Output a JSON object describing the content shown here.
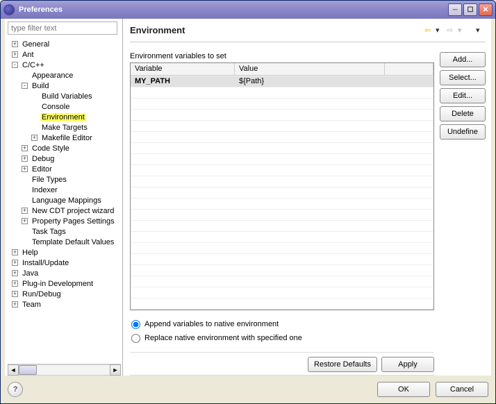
{
  "window": {
    "title": "Preferences"
  },
  "filter": {
    "placeholder": "type filter text"
  },
  "tree": {
    "nodes": [
      {
        "indent": 0,
        "twisty": "+",
        "label": "General"
      },
      {
        "indent": 0,
        "twisty": "+",
        "label": "Ant"
      },
      {
        "indent": 0,
        "twisty": "-",
        "label": "C/C++"
      },
      {
        "indent": 1,
        "twisty": "",
        "label": "Appearance"
      },
      {
        "indent": 1,
        "twisty": "-",
        "label": "Build"
      },
      {
        "indent": 2,
        "twisty": "",
        "label": "Build Variables"
      },
      {
        "indent": 2,
        "twisty": "",
        "label": "Console"
      },
      {
        "indent": 2,
        "twisty": "",
        "label": "Environment",
        "selected": true
      },
      {
        "indent": 2,
        "twisty": "",
        "label": "Make Targets"
      },
      {
        "indent": 2,
        "twisty": "+",
        "label": "Makefile Editor"
      },
      {
        "indent": 1,
        "twisty": "+",
        "label": "Code Style"
      },
      {
        "indent": 1,
        "twisty": "+",
        "label": "Debug"
      },
      {
        "indent": 1,
        "twisty": "+",
        "label": "Editor"
      },
      {
        "indent": 1,
        "twisty": "",
        "label": "File Types"
      },
      {
        "indent": 1,
        "twisty": "",
        "label": "Indexer"
      },
      {
        "indent": 1,
        "twisty": "",
        "label": "Language Mappings"
      },
      {
        "indent": 1,
        "twisty": "+",
        "label": "New CDT project wizard"
      },
      {
        "indent": 1,
        "twisty": "+",
        "label": "Property Pages Settings"
      },
      {
        "indent": 1,
        "twisty": "",
        "label": "Task Tags"
      },
      {
        "indent": 1,
        "twisty": "",
        "label": "Template Default Values"
      },
      {
        "indent": 0,
        "twisty": "+",
        "label": "Help"
      },
      {
        "indent": 0,
        "twisty": "+",
        "label": "Install/Update"
      },
      {
        "indent": 0,
        "twisty": "+",
        "label": "Java"
      },
      {
        "indent": 0,
        "twisty": "+",
        "label": "Plug-in Development"
      },
      {
        "indent": 0,
        "twisty": "+",
        "label": "Run/Debug"
      },
      {
        "indent": 0,
        "twisty": "+",
        "label": "Team"
      }
    ]
  },
  "page": {
    "heading": "Environment",
    "table_caption": "Environment variables to set",
    "columns": {
      "variable": "Variable",
      "value": "Value"
    },
    "rows": [
      {
        "variable": "MY_PATH",
        "value": "${Path}",
        "selected": true
      }
    ],
    "radios": {
      "append": "Append variables to native environment",
      "replace": "Replace native environment with specified one"
    }
  },
  "buttons": {
    "add": "Add...",
    "select": "Select...",
    "edit": "Edit...",
    "delete": "Delete",
    "undefine": "Undefine",
    "restore": "Restore Defaults",
    "apply": "Apply",
    "ok": "OK",
    "cancel": "Cancel"
  }
}
